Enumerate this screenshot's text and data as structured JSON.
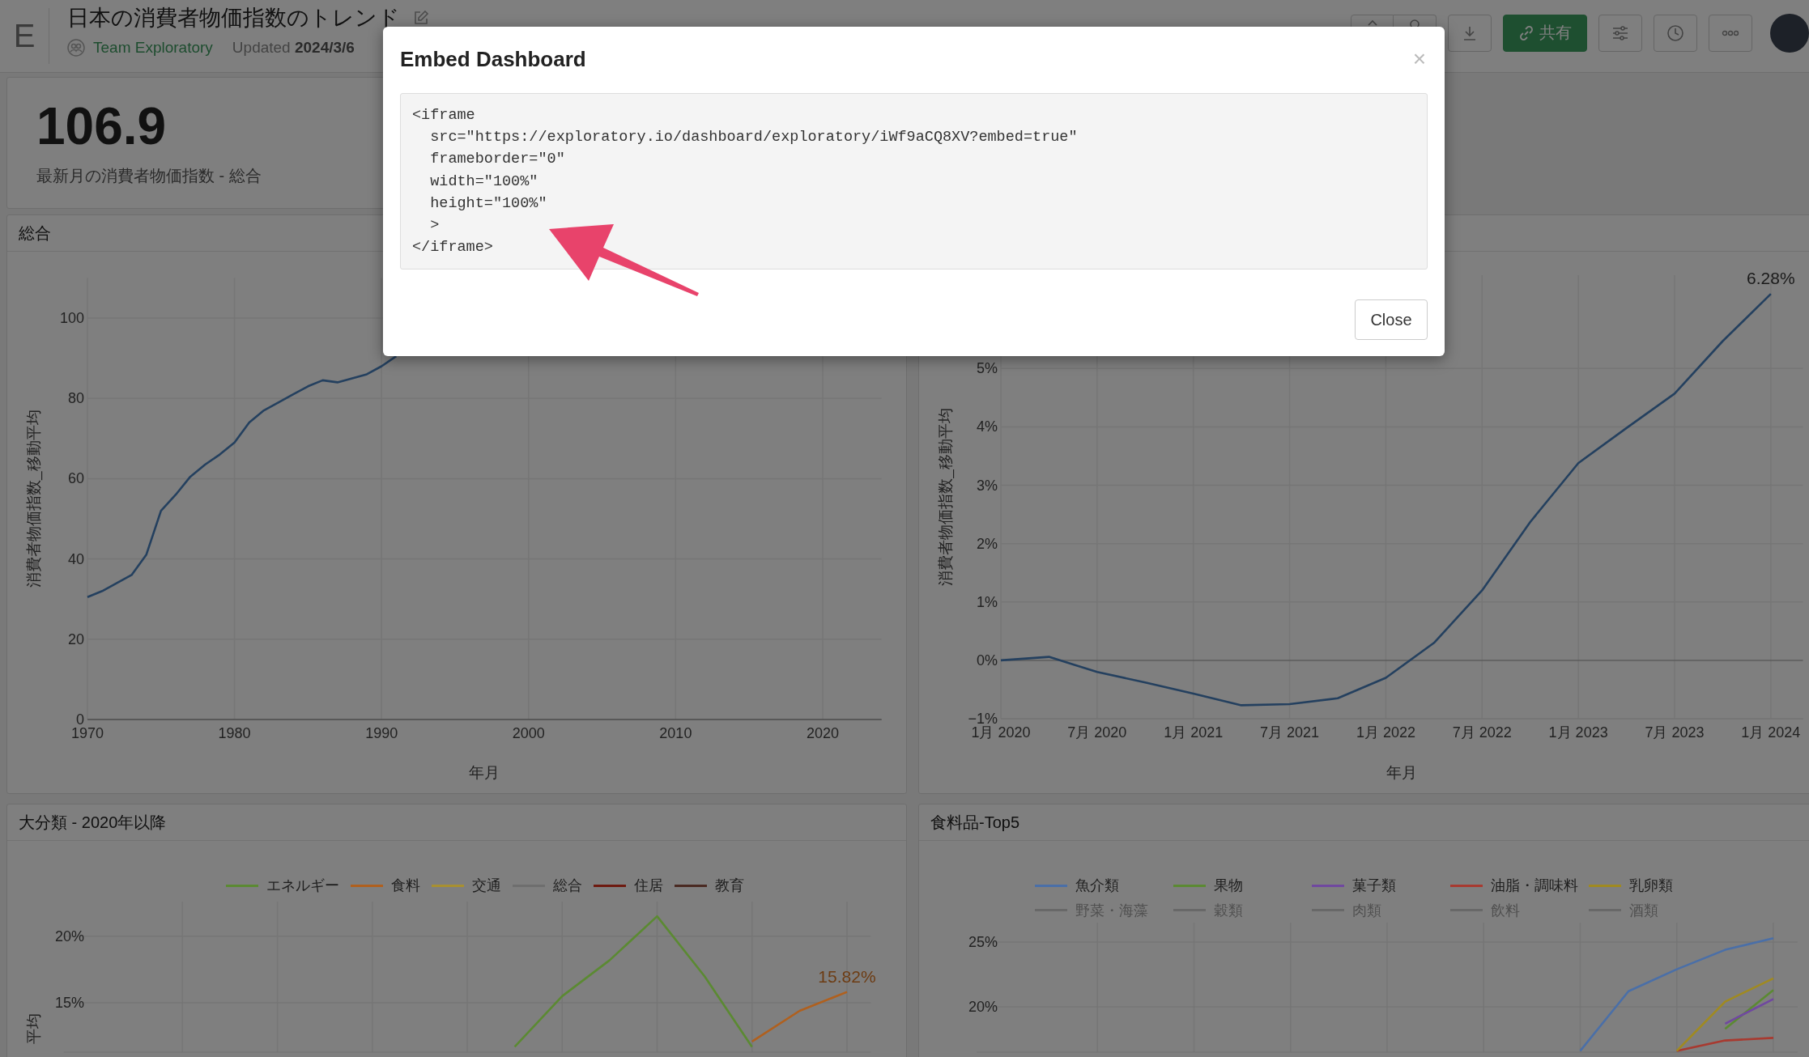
{
  "header": {
    "logo": "E",
    "title": "日本の消費者物価指数のトレンド",
    "team": "Team Exploratory",
    "updated": "Updated **2024/3/6**",
    "share_button": "共有"
  },
  "kpi": {
    "value": "106.9",
    "label": "最新月の消費者物価指数 - 総合"
  },
  "cards": [
    {
      "title": "総合",
      "chart_data": {
        "type": "line",
        "grid": true,
        "xlabel": "年月",
        "ylabel": "消費者物価指数_移動平均",
        "x": [
          1970,
          1971,
          1972,
          1973,
          1974,
          1975,
          1976,
          1977,
          1978,
          1979,
          1980,
          1981,
          1982,
          1983,
          1984,
          1985,
          1986,
          1987,
          1988,
          1989,
          1990,
          1991
        ],
        "series": [
          {
            "color": "#24405f",
            "values": [
              30.5,
              32,
              34,
              36,
              41,
              52,
              56,
              60.5,
              63.5,
              66,
              69,
              74,
              77,
              79,
              81,
              83,
              84.5,
              84,
              85,
              86,
              88,
              90.5
            ]
          }
        ],
        "xlim": [
          1970,
          2024
        ],
        "ylim": [
          0,
          110
        ],
        "xticks": [
          1970,
          1980,
          1990,
          2000,
          2010,
          2020
        ],
        "yticks": [
          0,
          20,
          40,
          60,
          80,
          100
        ]
      }
    },
    {
      "chart_data": {
        "type": "line",
        "grid": true,
        "xlabel": "年月",
        "ylabel": "消費者物価指数_移動平均",
        "categories": [
          "1月 2020",
          null,
          "7月 2020",
          null,
          "1月 2021",
          null,
          "7月 2021",
          null,
          "1月 2022",
          null,
          "7月 2022",
          null,
          "1月 2023",
          null,
          "7月 2023",
          null,
          "1月 2024"
        ],
        "series": [
          {
            "color": "#24405f",
            "values": [
              0,
              0.06,
              -0.2,
              -0.38,
              -0.57,
              -0.77,
              -0.75,
              -0.65,
              -0.3,
              0.3,
              1.2,
              2.37,
              3.38,
              3.98,
              4.57,
              5.47,
              6.28
            ]
          }
        ],
        "ylim": [
          -1,
          6.6
        ],
        "yticks": [
          {
            "value": -1,
            "label": "−1%"
          },
          {
            "value": 0,
            "label": "0%"
          },
          {
            "value": 1,
            "label": "1%"
          },
          {
            "value": 2,
            "label": "2%"
          },
          {
            "value": 3,
            "label": "3%"
          },
          {
            "value": 4,
            "label": "4%"
          },
          {
            "value": 5,
            "label": "5%"
          }
        ],
        "annotations": [
          {
            "y": 6.28,
            "text": "6.28%"
          }
        ]
      }
    },
    {
      "title": "大分類 - 2020年以降",
      "chart_data": {
        "type": "line",
        "grid": true,
        "ylabel": "平均",
        "categories": [
          null,
          null,
          null,
          null,
          null,
          null,
          null,
          null,
          null,
          null,
          null,
          null,
          null,
          null,
          null,
          null,
          null
        ],
        "series": [
          {
            "name": "エネルギー",
            "color": "#5b8a32",
            "values": [
              null,
              null,
              null,
              null,
              null,
              null,
              null,
              null,
              null,
              11.7,
              15.5,
              18.2,
              21.5,
              17,
              11.7,
              null,
              null
            ]
          },
          {
            "name": "食料",
            "color": "#b0601e",
            "values": [
              null,
              null,
              null,
              null,
              null,
              null,
              null,
              null,
              null,
              null,
              null,
              null,
              null,
              null,
              12.1,
              14.4,
              15.82
            ]
          },
          {
            "name": "交通",
            "color": "#a89030",
            "values": [
              null,
              null,
              null,
              null,
              null,
              null,
              null,
              null,
              null,
              null,
              null,
              null,
              null,
              null,
              null,
              null,
              null
            ]
          },
          {
            "name": "総合",
            "color": "#6e6e6e",
            "values": [
              null,
              null,
              null,
              null,
              null,
              null,
              null,
              null,
              null,
              null,
              null,
              null,
              null,
              null,
              null,
              null,
              null
            ]
          },
          {
            "name": "住居",
            "color": "#6e1a10",
            "values": [
              null,
              null,
              null,
              null,
              null,
              null,
              null,
              null,
              null,
              null,
              null,
              null,
              null,
              null,
              null,
              null,
              null
            ]
          },
          {
            "name": "教育",
            "color": "#4a2a22",
            "values": [
              null,
              null,
              null,
              null,
              null,
              null,
              null,
              null,
              null,
              null,
              null,
              null,
              null,
              null,
              null,
              null,
              null
            ]
          }
        ],
        "ylim": [
          11.3,
          22.6
        ],
        "yticks": [
          {
            "value": 15,
            "label": "15%"
          },
          {
            "value": 20,
            "label": "20%"
          }
        ],
        "annotations": [
          {
            "y": 15.82,
            "text": "15.82%"
          }
        ]
      }
    },
    {
      "title": "食料品-Top5",
      "legend_off": [
        "野菜・海藻",
        "穀類",
        "肉類",
        "飲料",
        "酒類"
      ],
      "chart_data": {
        "type": "line",
        "grid": true,
        "categories": [
          null,
          null,
          null,
          null,
          null,
          null,
          null,
          null,
          null,
          null,
          null,
          null,
          null,
          null,
          null,
          null,
          null
        ],
        "series": [
          {
            "name": "魚介類",
            "color": "#4a6fa8",
            "values": [
              null,
              null,
              null,
              null,
              null,
              null,
              null,
              null,
              null,
              null,
              null,
              null,
              16.6,
              21.2,
              22.9,
              24.4,
              25.3
            ]
          },
          {
            "name": "果物",
            "color": "#5b8a32",
            "values": [
              null,
              null,
              null,
              null,
              null,
              null,
              null,
              null,
              null,
              null,
              null,
              null,
              null,
              null,
              null,
              18.3,
              21.3
            ]
          },
          {
            "name": "菓子類",
            "color": "#7048a0",
            "values": [
              null,
              null,
              null,
              null,
              null,
              null,
              null,
              null,
              null,
              null,
              null,
              null,
              null,
              null,
              null,
              18.7,
              20.6
            ]
          },
          {
            "name": "油脂・調味料",
            "color": "#a83a30",
            "values": [
              null,
              null,
              null,
              null,
              null,
              null,
              null,
              null,
              null,
              null,
              null,
              null,
              null,
              null,
              16.6,
              17.4,
              17.6
            ]
          },
          {
            "name": "乳卵類",
            "color": "#a08a20",
            "values": [
              null,
              null,
              null,
              null,
              null,
              null,
              null,
              null,
              null,
              null,
              null,
              null,
              null,
              null,
              16.6,
              20.4,
              22.2
            ]
          }
        ],
        "ylim": [
          16.5,
          26.5
        ],
        "yticks": [
          {
            "value": 20,
            "label": "20%"
          },
          {
            "value": 25,
            "label": "25%"
          }
        ]
      }
    }
  ],
  "modal": {
    "title": "Embed Dashboard",
    "close_icon": "×",
    "code_lines": [
      "<iframe",
      "  src=\"https://exploratory.io/dashboard/exploratory/iWf9aCQ8XV?embed=true\"",
      "  frameborder=\"0\"",
      "  width=\"100%\"",
      "  height=\"100%\"",
      "  >",
      "</iframe>"
    ],
    "close_button": "Close"
  }
}
